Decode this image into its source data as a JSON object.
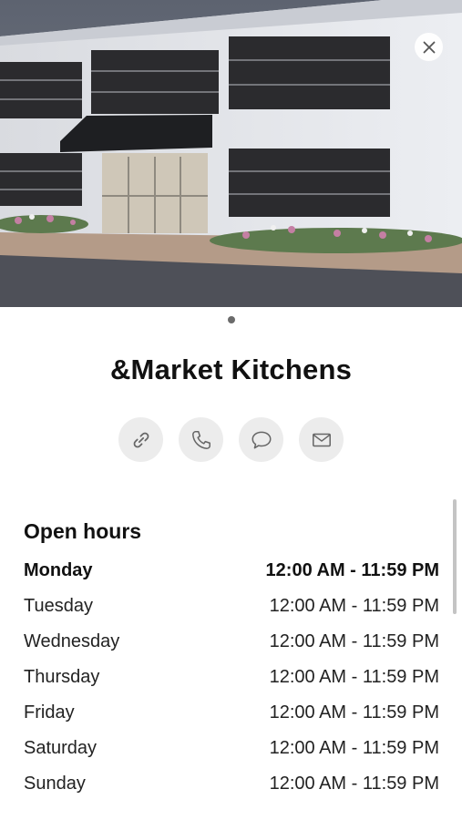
{
  "place": {
    "name": "&Market Kitchens"
  },
  "photo": {
    "count": 1,
    "current": 1
  },
  "actions": [
    {
      "icon": "link-icon"
    },
    {
      "icon": "phone-icon"
    },
    {
      "icon": "message-icon"
    },
    {
      "icon": "mail-icon"
    }
  ],
  "hours": {
    "title": "Open hours",
    "today": "Monday",
    "days": [
      {
        "day": "Monday",
        "time": "12:00 AM - 11:59 PM"
      },
      {
        "day": "Tuesday",
        "time": "12:00 AM - 11:59 PM"
      },
      {
        "day": "Wednesday",
        "time": "12:00 AM - 11:59 PM"
      },
      {
        "day": "Thursday",
        "time": "12:00 AM - 11:59 PM"
      },
      {
        "day": "Friday",
        "time": "12:00 AM - 11:59 PM"
      },
      {
        "day": "Saturday",
        "time": "12:00 AM - 11:59 PM"
      },
      {
        "day": "Sunday",
        "time": "12:00 AM - 11:59 PM"
      }
    ]
  },
  "colors": {
    "accent": "#111111",
    "button_bg": "#ececec"
  }
}
